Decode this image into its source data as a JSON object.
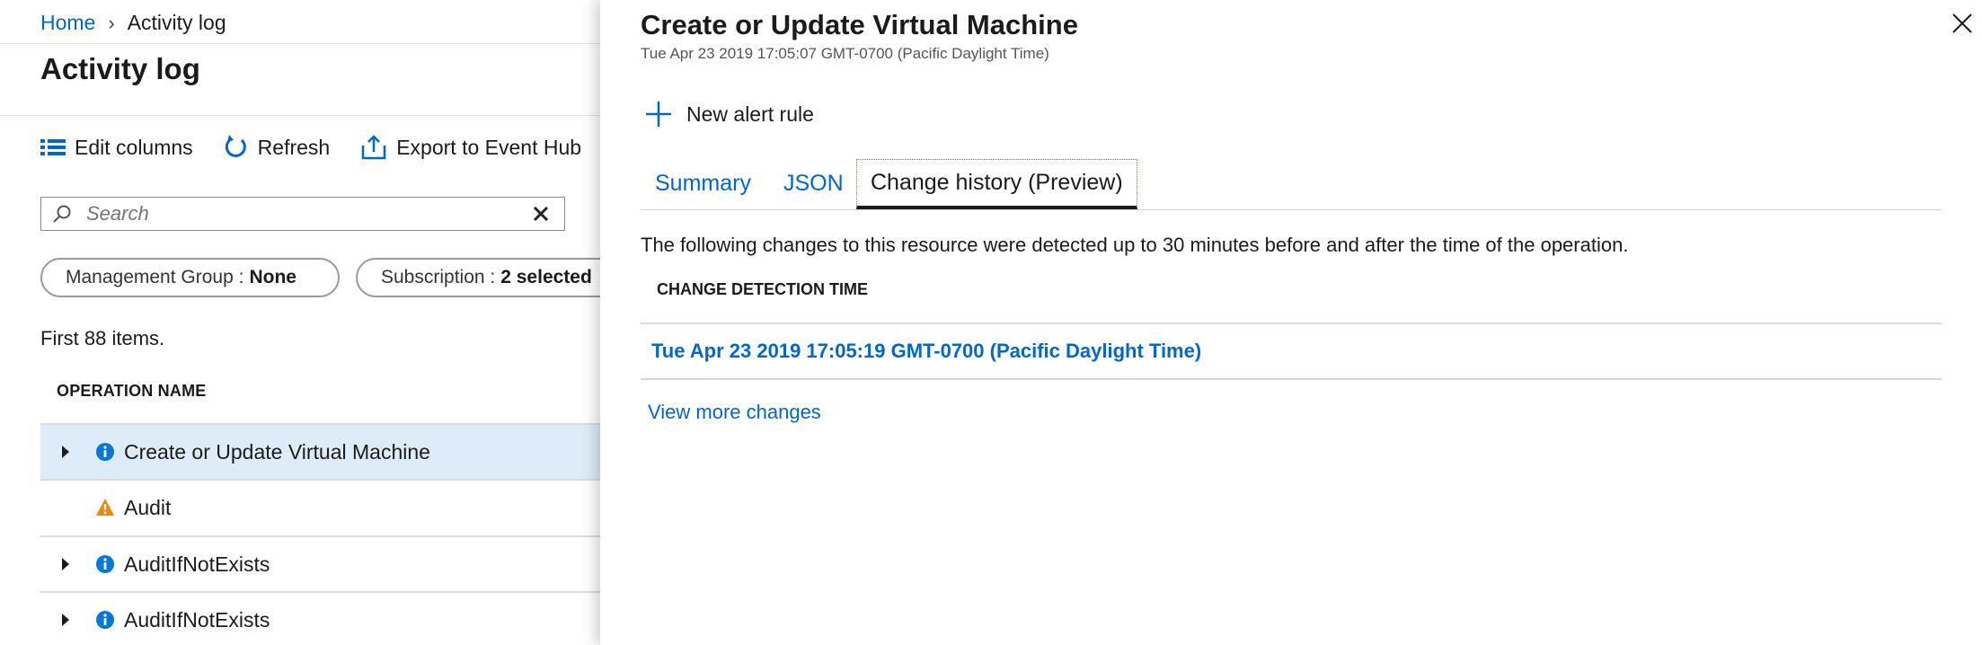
{
  "breadcrumb": {
    "home": "Home",
    "separator": "›",
    "current": "Activity log"
  },
  "page": {
    "title": "Activity log"
  },
  "toolbar": {
    "edit_columns": "Edit columns",
    "refresh": "Refresh",
    "export": "Export to Event Hub"
  },
  "search": {
    "placeholder": "Search"
  },
  "filters": [
    {
      "label": "Management Group :",
      "value": "None"
    },
    {
      "label": "Subscription :",
      "value": "2 selected"
    }
  ],
  "list": {
    "count_text": "First 88 items.",
    "column_header": "OPERATION NAME",
    "rows": [
      {
        "name": "Create or Update Virtual Machine",
        "status": "info",
        "expandable": true,
        "selected": true
      },
      {
        "name": "Audit",
        "status": "warning",
        "expandable": false,
        "selected": false
      },
      {
        "name": "AuditIfNotExists",
        "status": "info",
        "expandable": true,
        "selected": false
      },
      {
        "name": "AuditIfNotExists",
        "status": "info",
        "expandable": true,
        "selected": false
      }
    ]
  },
  "panel": {
    "title": "Create or Update Virtual Machine",
    "subtitle": "Tue Apr 23 2019 17:05:07 GMT-0700 (Pacific Daylight Time)",
    "new_alert_rule": "New alert rule",
    "tabs": [
      {
        "label": "Summary",
        "active": false
      },
      {
        "label": "JSON",
        "active": false
      },
      {
        "label": "Change history (Preview)",
        "active": true
      }
    ],
    "description": "The following changes to this resource were detected up to 30 minutes before and after the time of the operation.",
    "column_header": "CHANGE DETECTION TIME",
    "change_time": "Tue Apr 23 2019 17:05:19 GMT-0700 (Pacific Daylight Time)",
    "view_more": "View more changes"
  },
  "colors": {
    "link_blue": "#0066c8",
    "selected_row": "#deecf9",
    "info_icon": "#0078d4",
    "warning_icon": "#f2830d"
  },
  "icons": [
    "chevron-right-icon",
    "columns-icon",
    "refresh-icon",
    "export-icon",
    "search-icon",
    "clear-icon",
    "caret-right-icon",
    "info-icon",
    "warning-icon",
    "close-icon",
    "plus-icon"
  ]
}
